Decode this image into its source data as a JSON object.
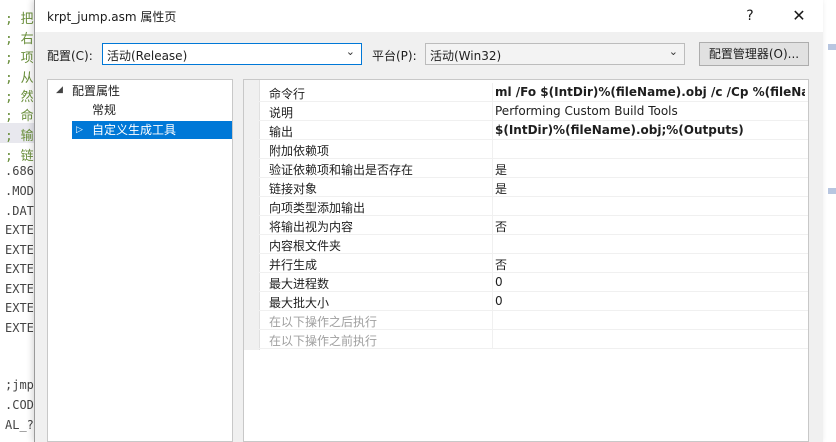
{
  "editor": {
    "lines": [
      {
        "text": "; 把",
        "kind": "comment"
      },
      {
        "text": "; 右",
        "kind": "comment"
      },
      {
        "text": "; 项",
        "kind": "comment"
      },
      {
        "text": "; 从",
        "kind": "comment"
      },
      {
        "text": "; 然",
        "kind": "comment"
      },
      {
        "text": "; 命",
        "kind": "comment"
      },
      {
        "text": "; 输",
        "kind": "comment"
      },
      {
        "text": "; 链",
        "kind": "comment"
      },
      {
        "text": ".686",
        "kind": "code"
      },
      {
        "text": ".MOD",
        "kind": "code"
      },
      {
        "text": ".DAT",
        "kind": "code"
      },
      {
        "text": "EXTE",
        "kind": "code"
      },
      {
        "text": "EXTE",
        "kind": "code"
      },
      {
        "text": "EXTE",
        "kind": "code"
      },
      {
        "text": "EXTE",
        "kind": "code"
      },
      {
        "text": "EXTE",
        "kind": "code"
      },
      {
        "text": "EXTE",
        "kind": "code"
      },
      {
        "text": ";jmp",
        "kind": "code"
      },
      {
        "text": ".COD",
        "kind": "code"
      },
      {
        "text": "AL_?",
        "kind": "code"
      }
    ]
  },
  "dialog": {
    "title": "krpt_jump.asm 属性页",
    "help_label": "?",
    "close_label": "✕"
  },
  "config": {
    "label": "配置(C):",
    "value": "活动(Release)",
    "platform_label": "平台(P):",
    "platform_value": "活动(Win32)",
    "manager_button": "配置管理器(O)..."
  },
  "tree": {
    "root": "配置属性",
    "items": [
      "常规",
      "自定义生成工具"
    ],
    "selected": "自定义生成工具"
  },
  "properties": [
    {
      "name": "命令行",
      "value": "ml /Fo $(IntDir)%(fileName).obj /c /Cp %(fileName).asm",
      "bold": true,
      "disabled": false
    },
    {
      "name": "说明",
      "value": "Performing Custom Build Tools",
      "bold": false,
      "disabled": false
    },
    {
      "name": "输出",
      "value": "$(IntDir)%(fileName).obj;%(Outputs)",
      "bold": true,
      "disabled": false
    },
    {
      "name": "附加依赖项",
      "value": "",
      "bold": false,
      "disabled": false
    },
    {
      "name": "验证依赖项和输出是否存在",
      "value": "是",
      "bold": false,
      "disabled": false
    },
    {
      "name": "链接对象",
      "value": "是",
      "bold": false,
      "disabled": false
    },
    {
      "name": "向项类型添加输出",
      "value": "",
      "bold": false,
      "disabled": false
    },
    {
      "name": "将输出视为内容",
      "value": "否",
      "bold": false,
      "disabled": false
    },
    {
      "name": "内容根文件夹",
      "value": "",
      "bold": false,
      "disabled": false
    },
    {
      "name": "并行生成",
      "value": "否",
      "bold": false,
      "disabled": false
    },
    {
      "name": "最大进程数",
      "value": "0",
      "bold": false,
      "disabled": false
    },
    {
      "name": "最大批大小",
      "value": "0",
      "bold": false,
      "disabled": false
    },
    {
      "name": "在以下操作之后执行",
      "value": "",
      "bold": false,
      "disabled": true
    },
    {
      "name": "在以下操作之前执行",
      "value": "",
      "bold": false,
      "disabled": true
    }
  ],
  "icons": {
    "expand": "expanded-triangle-icon",
    "collapse": "collapsed-triangle-icon",
    "dropdown": "chevron-down-icon"
  }
}
